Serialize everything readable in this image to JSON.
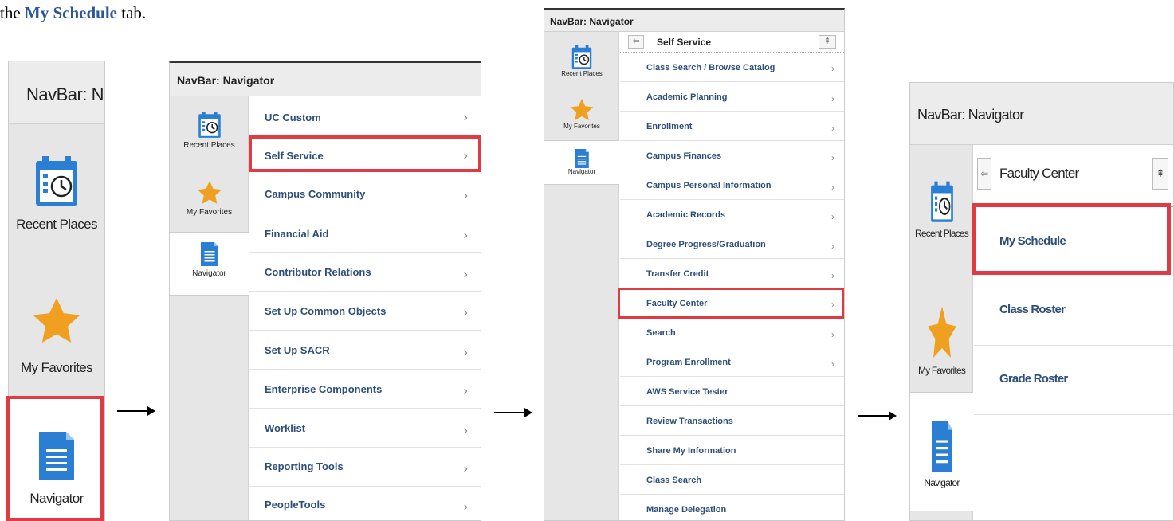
{
  "intro": {
    "text_prefix": "the ",
    "highlight": "My Schedule",
    "text_suffix": " tab."
  },
  "panel1": {
    "header": "NavBar: Nav",
    "tiles": {
      "recent": "Recent Places",
      "favorites": "My Favorites",
      "navigator": "Navigator"
    }
  },
  "panel2": {
    "header": "NavBar: Navigator",
    "tiles": {
      "recent": "Recent Places",
      "favorites": "My Favorites",
      "navigator": "Navigator"
    },
    "items": [
      "UC Custom",
      "Self Service",
      "Campus Community",
      "Financial Aid",
      "Contributor Relations",
      "Set Up Common Objects",
      "Set Up SACR",
      "Enterprise Components",
      "Worklist",
      "Reporting Tools",
      "PeopleTools"
    ]
  },
  "panel3": {
    "header": "NavBar: Navigator",
    "breadcrumb": "Self Service",
    "tiles": {
      "recent": "Recent Places",
      "favorites": "My Favorites",
      "navigator": "Navigator"
    },
    "items": [
      "Class Search / Browse Catalog",
      "Academic Planning",
      "Enrollment",
      "Campus Finances",
      "Campus Personal Information",
      "Academic Records",
      "Degree Progress/Graduation",
      "Transfer Credit",
      "Faculty Center",
      "Search",
      "Program Enrollment",
      "AWS Service Tester",
      "Review Transactions",
      "Share My Information",
      "Class Search",
      "Manage Delegation"
    ]
  },
  "panel4": {
    "header": "NavBar: Navigator",
    "breadcrumb": "Faculty Center",
    "tiles": {
      "recent": "Recent Places",
      "favorites": "My Favorites",
      "navigator": "Navigator"
    },
    "items": [
      "My Schedule",
      "Class Roster",
      "Grade Roster"
    ]
  },
  "colors": {
    "highlight_red": "#e03a42",
    "menu_text": "#2e4e7a",
    "icon_blue": "#2a7fd4",
    "star_orange": "#f0a020"
  }
}
